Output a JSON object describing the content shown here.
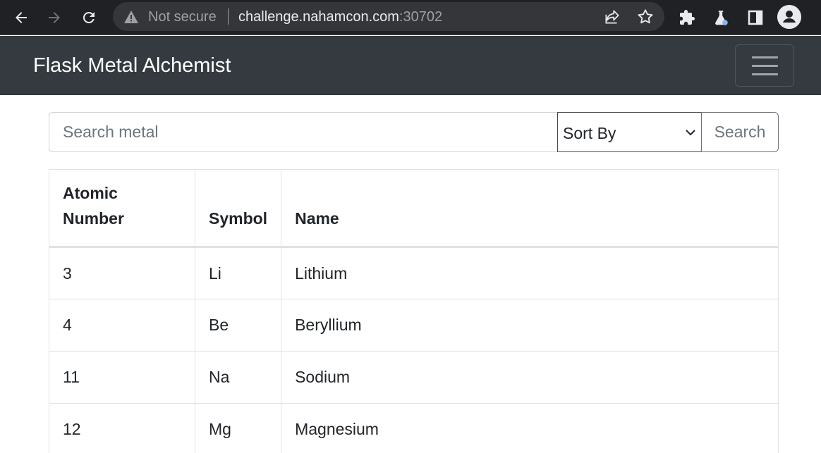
{
  "browser": {
    "security_label": "Not secure",
    "url_host": "challenge.nahamcon.com",
    "url_port": ":30702"
  },
  "navbar": {
    "brand": "Flask Metal Alchemist"
  },
  "search": {
    "placeholder": "Search metal",
    "sort_label": "Sort By",
    "button_label": "Search"
  },
  "table": {
    "headers": [
      "Atomic Number",
      "Symbol",
      "Name"
    ],
    "header_lines": {
      "atomic_1": "Atomic",
      "atomic_2": "Number"
    },
    "rows": [
      {
        "atomic_number": "3",
        "symbol": "Li",
        "name": "Lithium"
      },
      {
        "atomic_number": "4",
        "symbol": "Be",
        "name": "Beryllium"
      },
      {
        "atomic_number": "11",
        "symbol": "Na",
        "name": "Sodium"
      },
      {
        "atomic_number": "12",
        "symbol": "Mg",
        "name": "Magnesium"
      }
    ]
  },
  "icons": [
    "back-icon",
    "forward-icon",
    "reload-icon",
    "warning-icon",
    "share-icon",
    "star-icon",
    "puzzle-icon",
    "flask-icon",
    "sidepanel-icon",
    "profile-icon",
    "hamburger-icon",
    "chevron-down-icon"
  ]
}
